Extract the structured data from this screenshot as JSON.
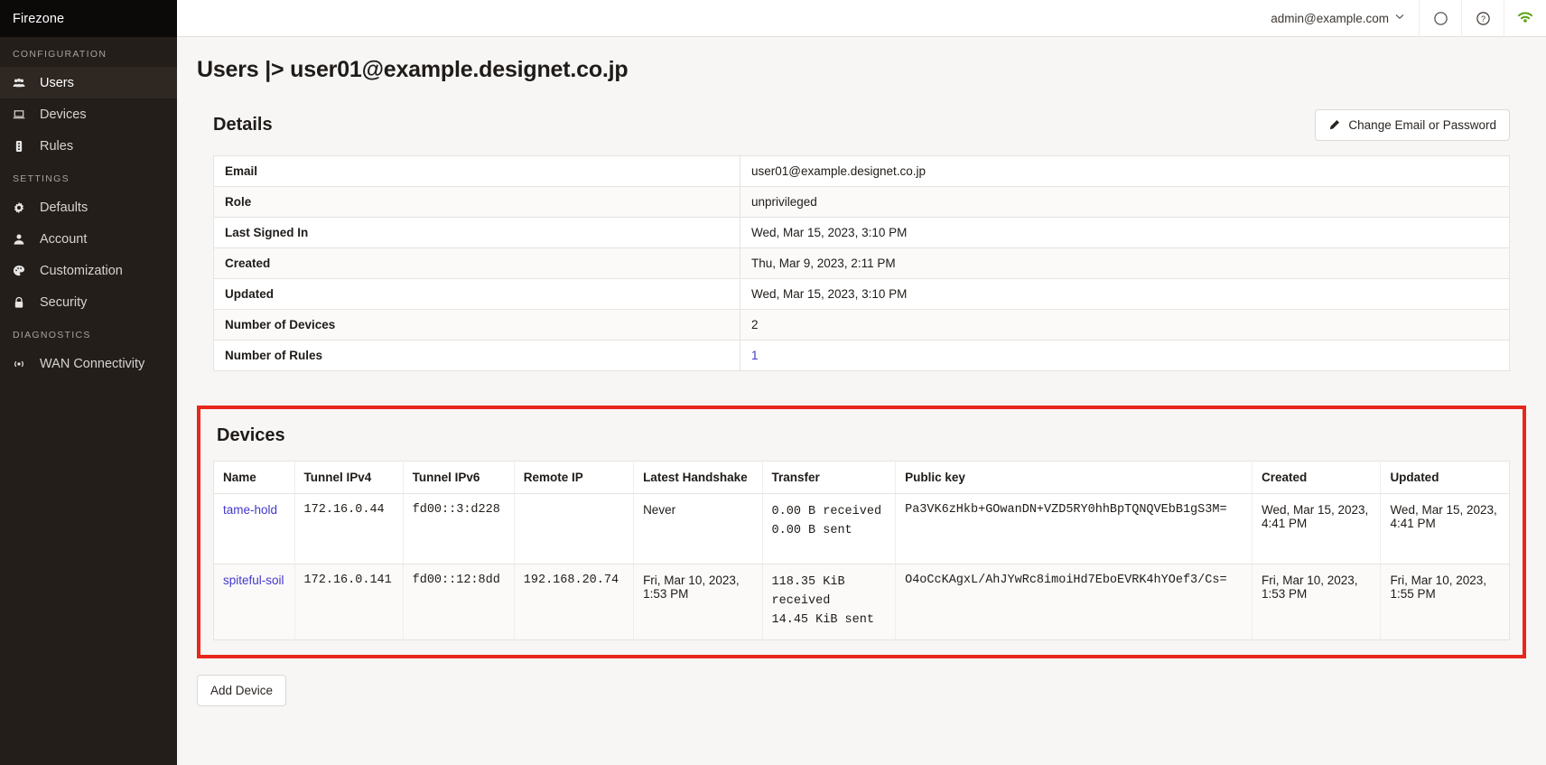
{
  "brand": {
    "name": "Firezone"
  },
  "sidebar": {
    "sections": [
      {
        "label": "CONFIGURATION",
        "items": [
          {
            "label": "Users",
            "icon": "users-icon",
            "active": true
          },
          {
            "label": "Devices",
            "icon": "laptop-icon",
            "active": false
          },
          {
            "label": "Rules",
            "icon": "traffic-light-icon",
            "active": false
          }
        ]
      },
      {
        "label": "SETTINGS",
        "items": [
          {
            "label": "Defaults",
            "icon": "gear-icon",
            "active": false
          },
          {
            "label": "Account",
            "icon": "person-icon",
            "active": false
          },
          {
            "label": "Customization",
            "icon": "palette-icon",
            "active": false
          },
          {
            "label": "Security",
            "icon": "lock-icon",
            "active": false
          }
        ]
      },
      {
        "label": "DIAGNOSTICS",
        "items": [
          {
            "label": "WAN Connectivity",
            "icon": "signal-icon",
            "active": false
          }
        ]
      }
    ]
  },
  "topbar": {
    "account_email": "admin@example.com",
    "chevron": "⌄",
    "icons": [
      {
        "name": "circle-status-icon"
      },
      {
        "name": "help-circle-icon"
      },
      {
        "name": "wifi-icon",
        "color": "#5aa310"
      }
    ]
  },
  "page": {
    "title": "Users |> user01@example.designet.co.jp"
  },
  "details": {
    "heading": "Details",
    "change_button": "Change Email or Password",
    "rows": [
      {
        "key": "Email",
        "value": "user01@example.designet.co.jp",
        "link": false
      },
      {
        "key": "Role",
        "value": "unprivileged",
        "link": false
      },
      {
        "key": "Last Signed In",
        "value": "Wed, Mar 15, 2023, 3:10 PM",
        "link": false
      },
      {
        "key": "Created",
        "value": "Thu, Mar 9, 2023, 2:11 PM",
        "link": false
      },
      {
        "key": "Updated",
        "value": "Wed, Mar 15, 2023, 3:10 PM",
        "link": false
      },
      {
        "key": "Number of Devices",
        "value": "2",
        "link": false
      },
      {
        "key": "Number of Rules",
        "value": "1",
        "link": true
      }
    ]
  },
  "devices": {
    "heading": "Devices",
    "highlight_color": "#e8271c",
    "columns": [
      "Name",
      "Tunnel IPv4",
      "Tunnel IPv6",
      "Remote IP",
      "Latest Handshake",
      "Transfer",
      "Public key",
      "Created",
      "Updated"
    ],
    "rows": [
      {
        "name": "tame-hold",
        "tunnel_ipv4": "172.16.0.44",
        "tunnel_ipv6": "fd00::3:d228",
        "remote_ip": "",
        "latest_handshake": "Never",
        "transfer_received": "0.00 B received",
        "transfer_sent": "0.00 B sent",
        "public_key": "Pa3VK6zHkb+GOwanDN+VZD5RY0hhBpTQNQVEbB1gS3M=",
        "created": "Wed, Mar 15, 2023, 4:41 PM",
        "updated": "Wed, Mar 15, 2023, 4:41 PM"
      },
      {
        "name": "spiteful-soil",
        "tunnel_ipv4": "172.16.0.141",
        "tunnel_ipv6": "fd00::12:8dd",
        "remote_ip": "192.168.20.74",
        "latest_handshake": "Fri, Mar 10, 2023, 1:53 PM",
        "transfer_received": "118.35 KiB received",
        "transfer_sent": "14.45 KiB sent",
        "public_key": "O4oCcKAgxL/AhJYwRc8imoiHd7EboEVRK4hYOef3/Cs=",
        "created": "Fri, Mar 10, 2023, 1:53 PM",
        "updated": "Fri, Mar 10, 2023, 1:55 PM"
      }
    ],
    "add_button": "Add Device"
  }
}
